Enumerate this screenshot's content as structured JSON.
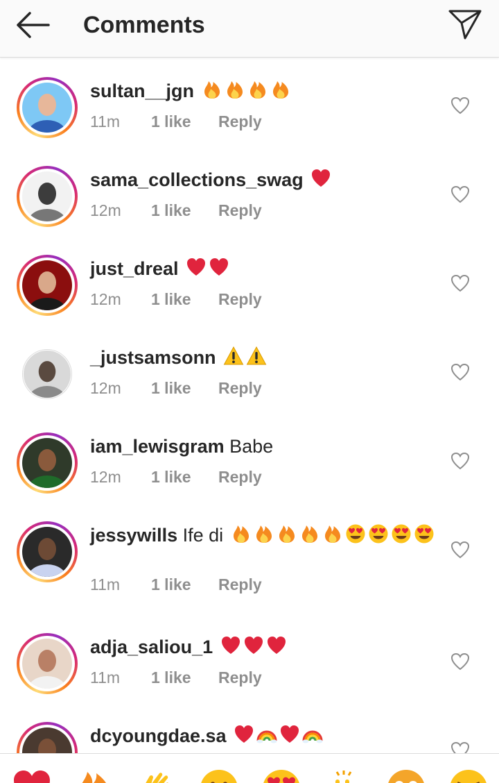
{
  "header": {
    "title": "Comments",
    "back_icon": "arrow-left-icon",
    "send_icon": "paper-plane-icon"
  },
  "comments": [
    {
      "username": "sultan__jgn",
      "text": "",
      "emojis": [
        "fire",
        "fire",
        "fire",
        "fire"
      ],
      "time": "11m",
      "likes": "1 like",
      "reply": "Reply",
      "ring": "story"
    },
    {
      "username": "sama_collections_swag",
      "text": "",
      "emojis": [
        "heart"
      ],
      "time": "12m",
      "likes": "1 like",
      "reply": "Reply",
      "ring": "story"
    },
    {
      "username": "just_dreal",
      "text": "",
      "emojis": [
        "heart",
        "heart"
      ],
      "time": "12m",
      "likes": "1 like",
      "reply": "Reply",
      "ring": "story"
    },
    {
      "username": "_justsamsonn",
      "text": "",
      "emojis": [
        "warning",
        "warning"
      ],
      "time": "12m",
      "likes": "1 like",
      "reply": "Reply",
      "ring": "seen"
    },
    {
      "username": "iam_lewisgram",
      "text": "Babe",
      "emojis": [],
      "time": "12m",
      "likes": "1 like",
      "reply": "Reply",
      "ring": "story"
    },
    {
      "username": "jessywills",
      "text": "Ife di",
      "emojis": [
        "fire",
        "fire",
        "fire",
        "fire",
        "fire",
        "heart-eyes",
        "heart-eyes",
        "heart-eyes",
        "heart-eyes"
      ],
      "time": "11m",
      "likes": "1 like",
      "reply": "Reply",
      "ring": "story"
    },
    {
      "username": "adja_saliou_1",
      "text": "",
      "emojis": [
        "heart",
        "heart",
        "heart"
      ],
      "time": "11m",
      "likes": "1 like",
      "reply": "Reply",
      "ring": "story"
    },
    {
      "username": "dcyoungdae.sa",
      "text": "",
      "emojis": [
        "heart",
        "rainbow",
        "heart",
        "rainbow"
      ],
      "time": "",
      "likes": "",
      "reply": "",
      "ring": "story"
    }
  ],
  "emoji_bar": [
    "heart",
    "fire",
    "clap",
    "smile",
    "heart-eyes",
    "raised-hands",
    "pleading",
    "laugh"
  ],
  "colors": {
    "text": "#262626",
    "meta": "#8e8e8e",
    "heart": "#e0243d",
    "fire": "#f58a1f"
  }
}
